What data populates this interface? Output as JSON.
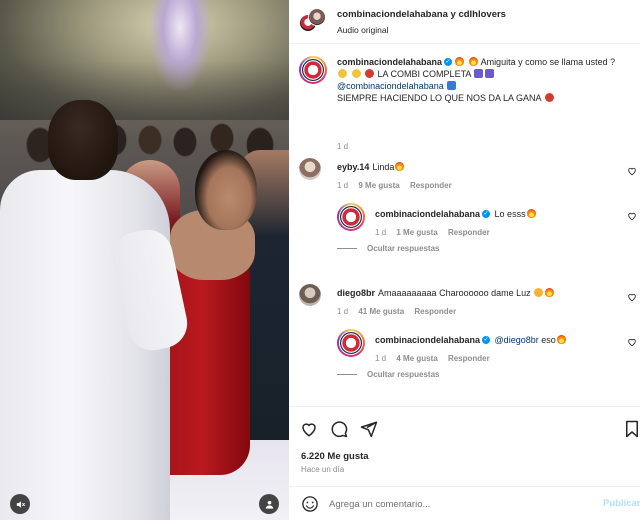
{
  "header": {
    "account_primary": "combinaciondelahabana",
    "joiner": " y ",
    "account_secondary": "cdlhlovers",
    "audio_label": "Audio original"
  },
  "caption": {
    "username": "combinaciondelahabana",
    "text_part1": "Amiguita y como se llama usted ?",
    "text_part2": "LA COMBI COMPLETA",
    "mention": "@combinaciondelahabana",
    "text_part3": "SIEMPRE HACIENDO LO QUE NOS DA LA GANA",
    "time": "1 d"
  },
  "comments": [
    {
      "username": "eyby.14",
      "text": "Linda",
      "time": "1 d",
      "likes": "9 Me gusta",
      "reply_label": "Responder"
    },
    {
      "username": "diego8br",
      "text": "Amaaaaaaaaa Charoooooo dame Luz",
      "time": "1 d",
      "likes": "41 Me gusta",
      "reply_label": "Responder"
    }
  ],
  "replies": [
    {
      "username": "combinaciondelahabana",
      "text": "Lo esss",
      "time": "1 d",
      "likes": "1 Me gusta",
      "reply_label": "Responder"
    },
    {
      "username": "combinaciondelahabana",
      "mention": "@diego8br",
      "text": "eso",
      "time": "1 d",
      "likes": "4 Me gusta",
      "reply_label": "Responder"
    }
  ],
  "hide_replies_label": "Ocultar respuestas",
  "footer": {
    "likes": "6.220 Me gusta",
    "posted": "Hace un día",
    "comment_placeholder": "Agrega un comentario...",
    "publish_label": "Publicar"
  },
  "icons": {
    "like": "heart-icon",
    "comment": "comment-icon",
    "share": "share-icon",
    "save": "bookmark-icon",
    "emoji": "smile-icon",
    "mute": "mute-icon",
    "tags": "user-tag-icon",
    "verified": "verified-badge-icon"
  },
  "colors": {
    "link": "#00376b",
    "verified": "#0095f6",
    "publish": "#b2dffc",
    "muted_text": "#8e8e8e"
  }
}
